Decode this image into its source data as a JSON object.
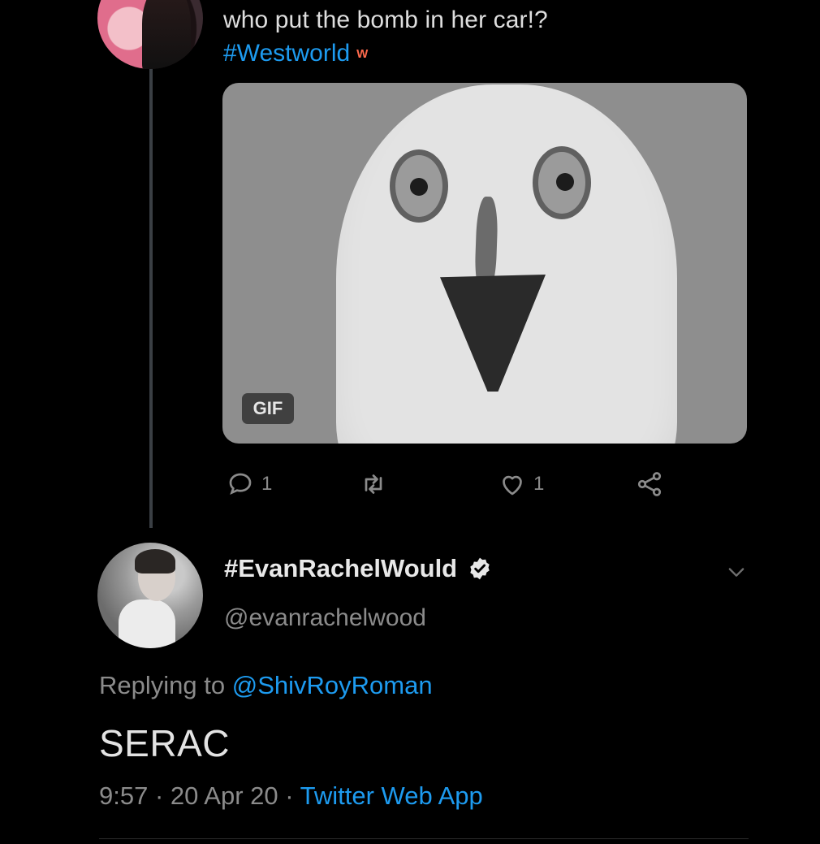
{
  "tweet1": {
    "text": "who put the bomb in her car!?",
    "hashtag": "#Westworld",
    "hashflag": "W",
    "gif_label": "GIF",
    "actions": {
      "reply_count": "1",
      "retweet_count": "",
      "like_count": "1"
    }
  },
  "tweet2": {
    "display_name": "#EvanRachelWould",
    "handle": "@evanrachelwood",
    "replying_prefix": "Replying to ",
    "replying_to": "@ShivRoyRoman",
    "text": "SERAC",
    "time": "9:57",
    "date": "20 Apr 20",
    "source": "Twitter Web App"
  },
  "colors": {
    "background": "#000000",
    "link": "#1d9bf0",
    "secondary_text": "#8b8b8b"
  },
  "icons": [
    "reply-icon",
    "retweet-icon",
    "like-icon",
    "share-icon",
    "verified-badge-icon",
    "chevron-down-icon"
  ]
}
